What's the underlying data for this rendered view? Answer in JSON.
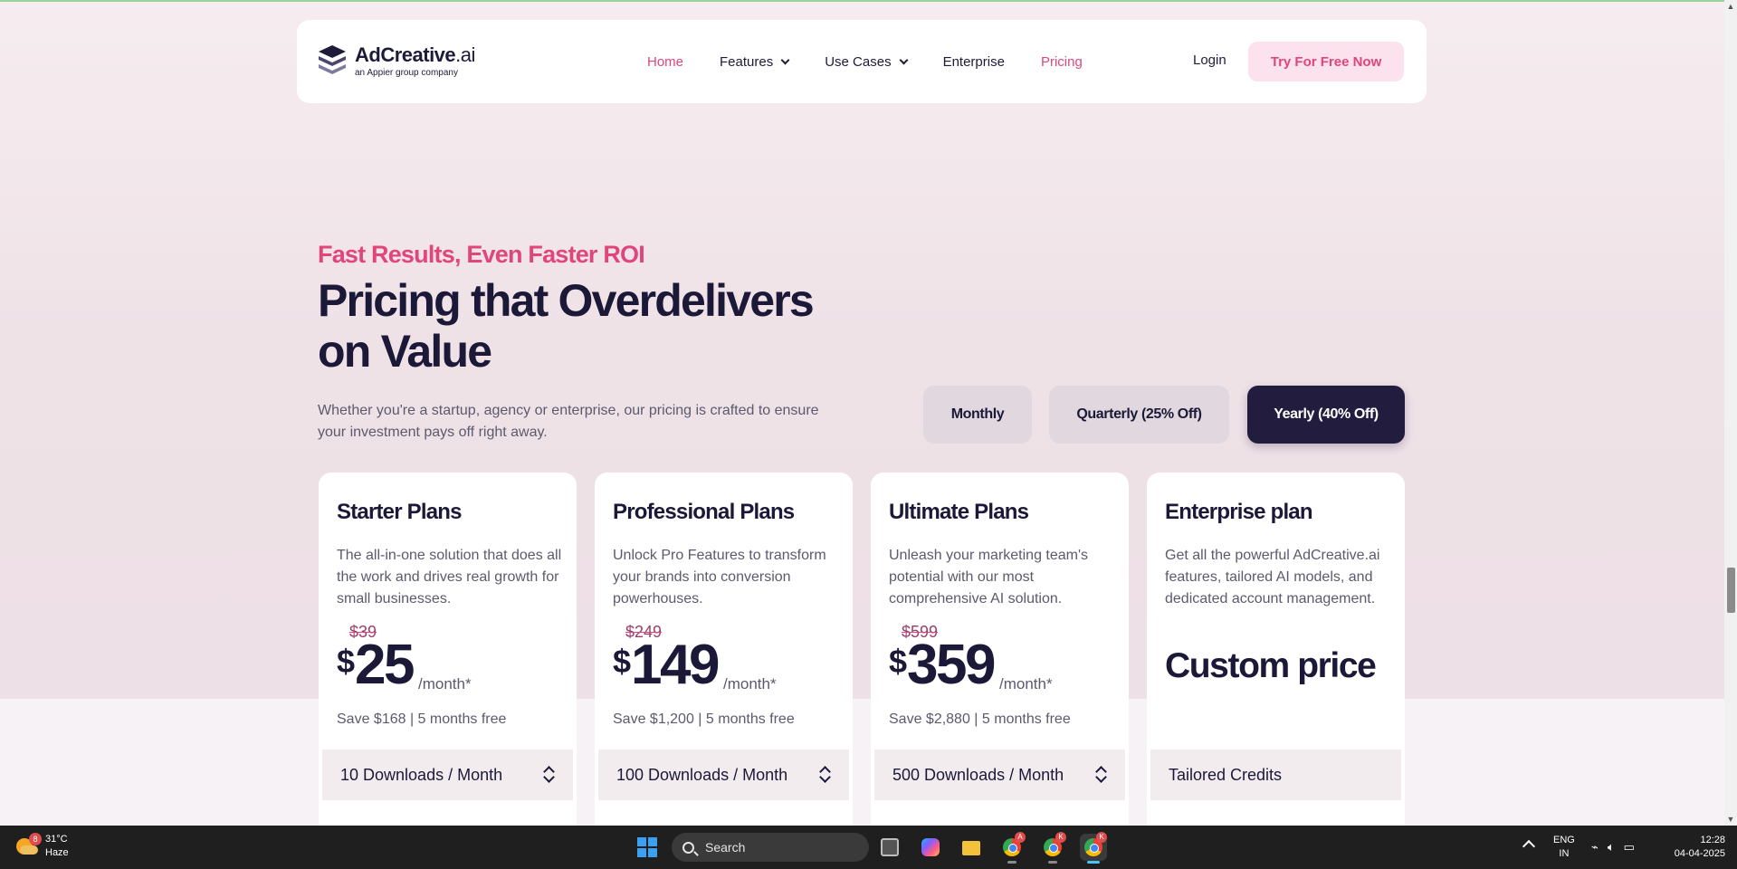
{
  "nav": {
    "brand": "AdCreative",
    "brand_suffix": ".ai",
    "brand_tagline": "an Appier group company",
    "links": [
      {
        "label": "Home"
      },
      {
        "label": "Features"
      },
      {
        "label": "Use Cases"
      },
      {
        "label": "Enterprise"
      },
      {
        "label": "Pricing"
      }
    ],
    "login": "Login",
    "cta": "Try For Free Now"
  },
  "hero": {
    "eyebrow": "Fast Results, Even Faster ROI",
    "headline": "Pricing that Overdelivers on Value",
    "subtext": "Whether you're a startup, agency or enterprise, our pricing is crafted to ensure your investment pays off right away."
  },
  "billing_toggle": {
    "monthly": "Monthly",
    "quarterly": "Quarterly (25% Off)",
    "yearly": "Yearly (40% Off)",
    "selected": "Yearly (40% Off)"
  },
  "plans": [
    {
      "title": "Starter Plans",
      "description": "The all-in-one solution that does all the work and drives real growth for small businesses.",
      "old_price": "$39",
      "currency": "$",
      "price": "25",
      "period": "/month*",
      "savings": "Save $168 | 5 months free",
      "downloads": "10 Downloads / Month"
    },
    {
      "title": "Professional Plans",
      "description": "Unlock Pro Features to transform your brands into conversion powerhouses.",
      "old_price": "$249",
      "currency": "$",
      "price": "149",
      "period": "/month*",
      "savings": "Save $1,200 | 5 months free",
      "downloads": "100 Downloads / Month"
    },
    {
      "title": "Ultimate Plans",
      "description": "Unleash your marketing team's potential with our most comprehensive AI solution.",
      "old_price": "$599",
      "currency": "$",
      "price": "359",
      "period": "/month*",
      "savings": "Save $2,880 | 5 months free",
      "downloads": "500 Downloads / Month"
    },
    {
      "title": "Enterprise plan",
      "description": "Get all the powerful AdCreative.ai features, tailored AI models, and dedicated account management.",
      "custom_price": "Custom price",
      "downloads": "Tailored Credits"
    }
  ],
  "taskbar": {
    "weather_temp": "31°C",
    "weather_desc": "Haze",
    "weather_badge": "8",
    "search_placeholder": "Search",
    "app_badges": [
      "A",
      "K",
      "K"
    ],
    "lang_line1": "ENG",
    "lang_line2": "IN",
    "time": "12:28",
    "date": "04-04-2025"
  },
  "colors": {
    "accent_pink": "#e0457b",
    "dark_navy": "#1c1838",
    "selected_toggle": "#221d3f"
  }
}
